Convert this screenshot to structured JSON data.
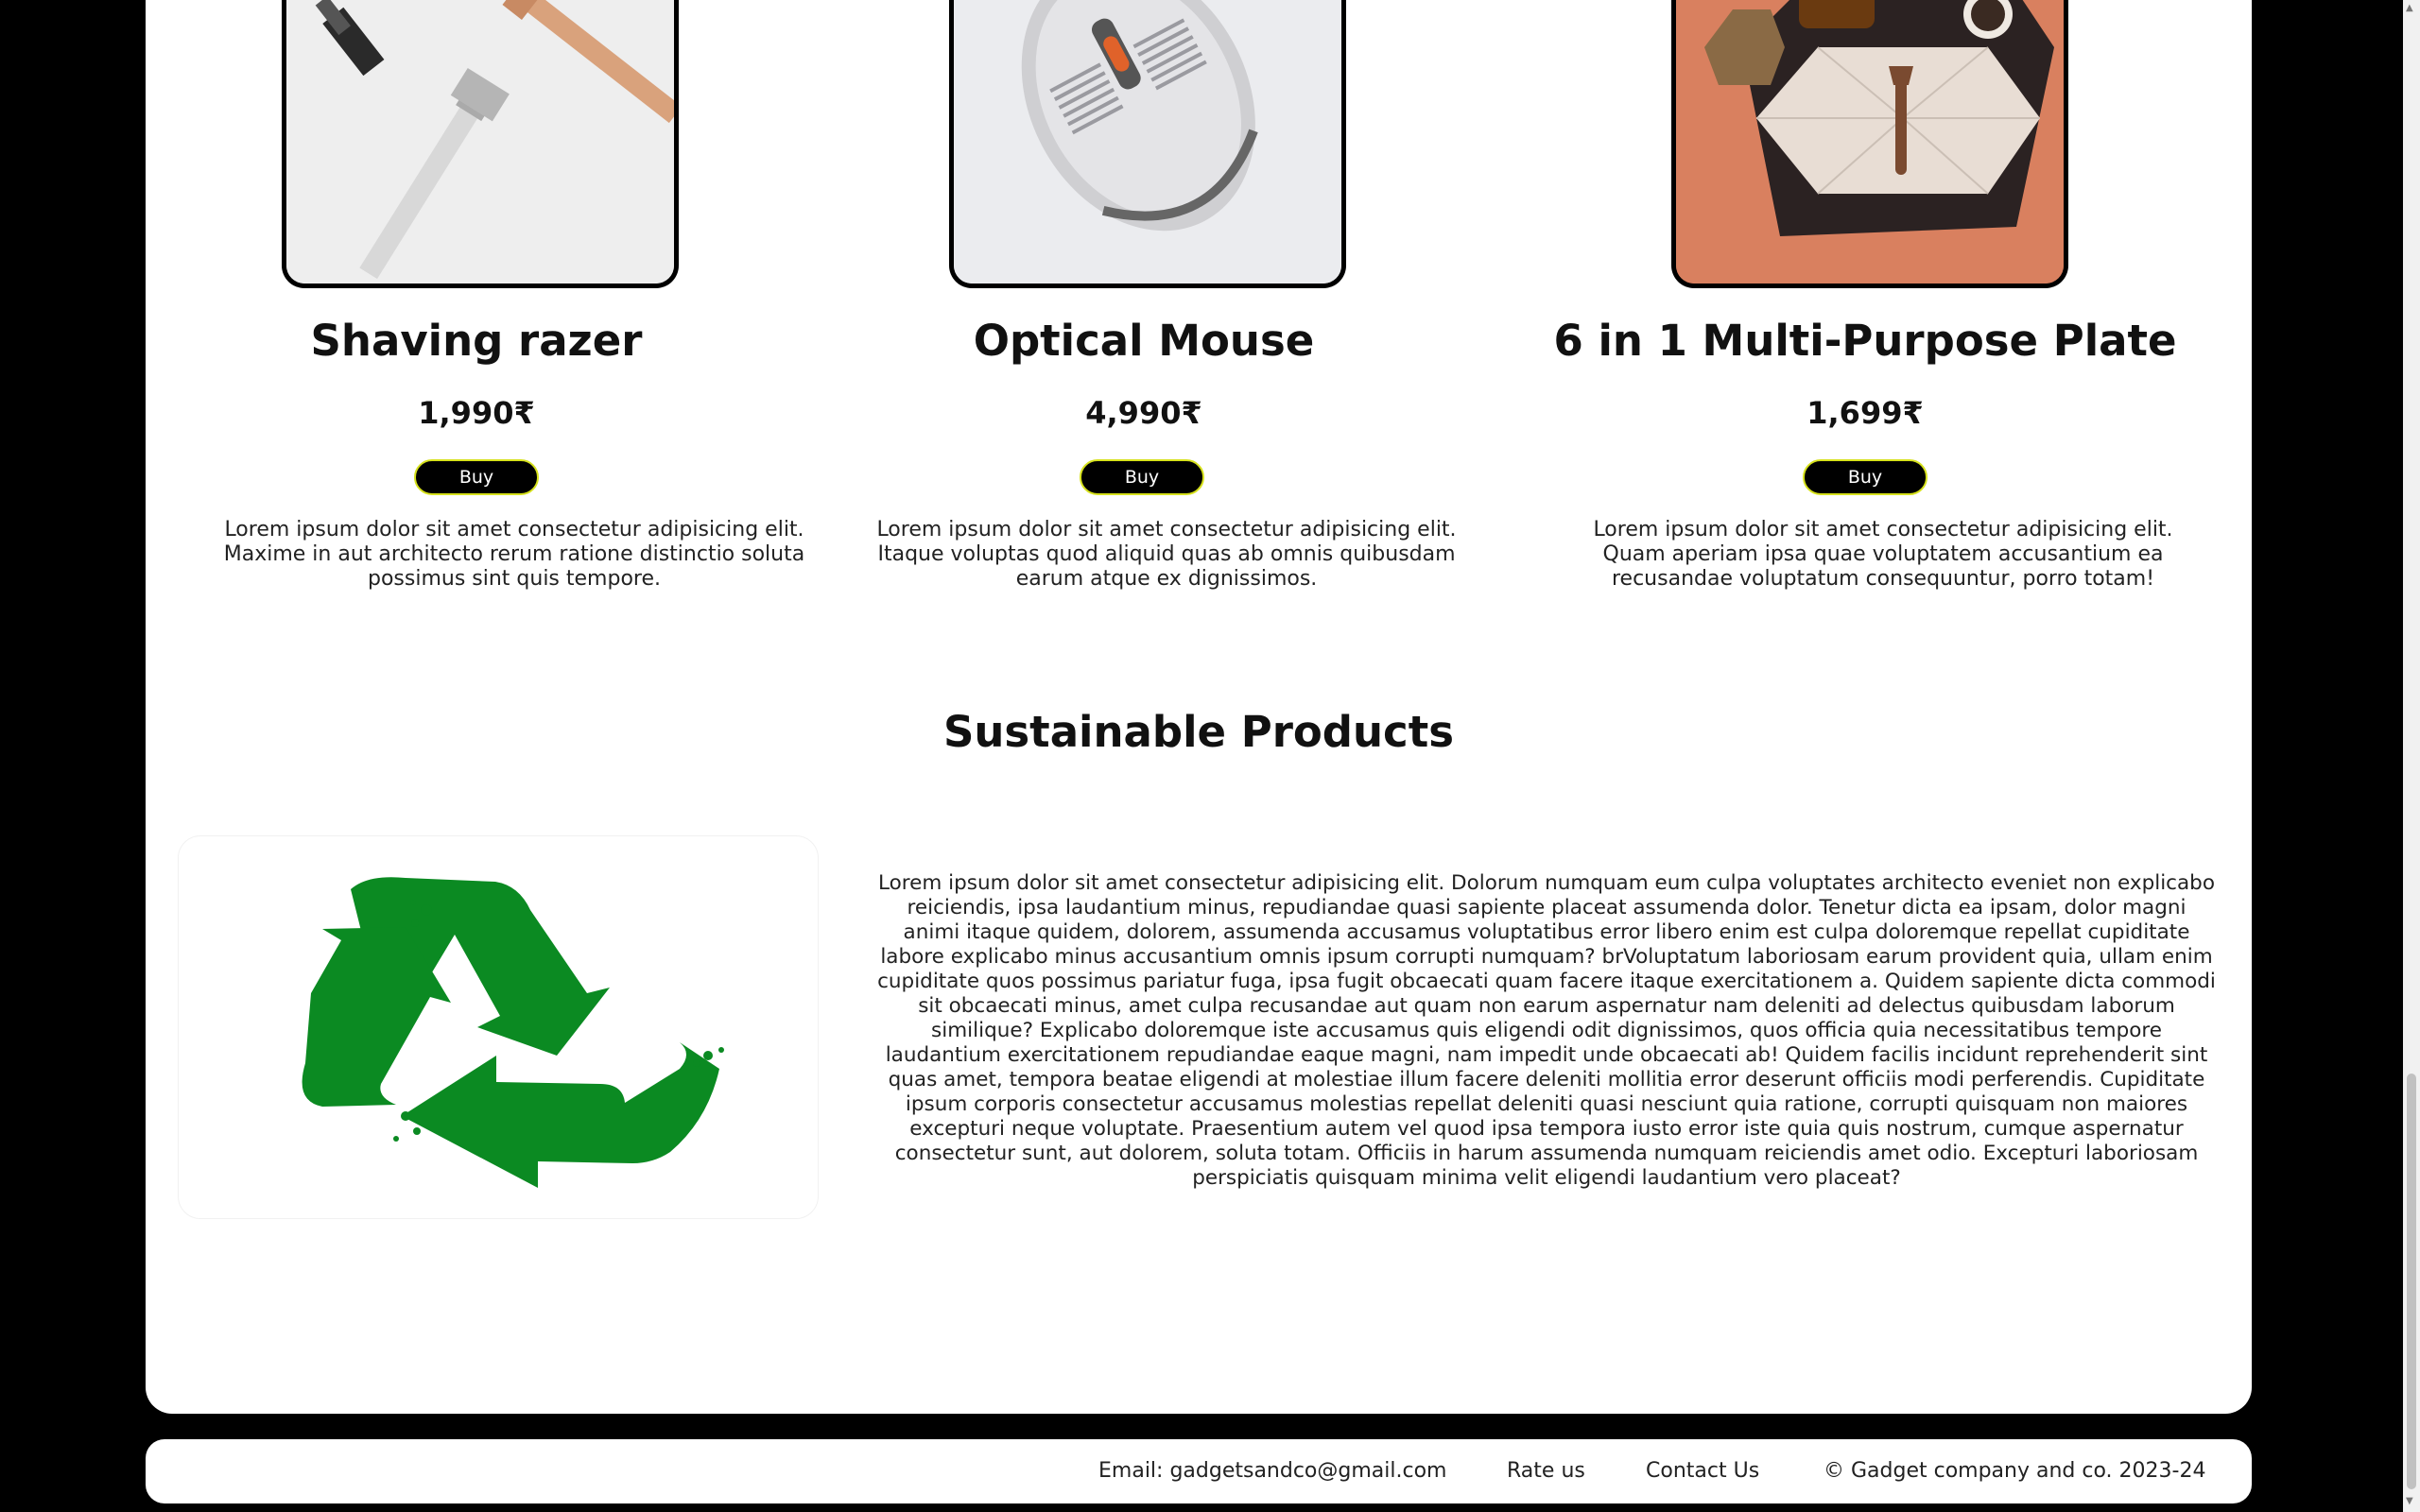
{
  "products": [
    {
      "name": "Shaving razer",
      "price": "1,990₹",
      "buy_label": "Buy",
      "description": "Lorem ipsum dolor sit amet consectetur adipisicing elit. Maxime in aut architecto rerum ratione distinctio soluta possimus sint quis tempore."
    },
    {
      "name": "Optical Mouse",
      "price": "4,990₹",
      "buy_label": "Buy",
      "description": "Lorem ipsum dolor sit amet consectetur adipisicing elit. Itaque voluptas quod aliquid quas ab omnis quibusdam earum atque ex dignissimos."
    },
    {
      "name": "6 in 1 Multi-Purpose Plate",
      "price": "1,699₹",
      "buy_label": "Buy",
      "description": "Lorem ipsum dolor sit amet consectetur adipisicing elit. Quam aperiam ipsa quae voluptatem accusantium ea recusandae voluptatum consequuntur, porro totam!"
    }
  ],
  "sustainable": {
    "title": "Sustainable Products",
    "icon": "recycle-icon",
    "description": "Lorem ipsum dolor sit amet consectetur adipisicing elit. Dolorum numquam eum culpa voluptates architecto eveniet non explicabo reiciendis, ipsa laudantium minus, repudiandae quasi sapiente placeat assumenda dolor. Tenetur dicta ea ipsam, dolor magni animi itaque quidem, dolorem, assumenda accusamus voluptatibus error libero enim est culpa doloremque repellat cupiditate labore explicabo minus accusantium omnis ipsum corrupti numquam? brVoluptatum laboriosam earum provident quia, ullam enim cupiditate quos possimus pariatur fuga, ipsa fugit obcaecati quam facere itaque exercitationem a. Quidem sapiente dicta commodi sit obcaecati minus, amet culpa recusandae aut quam non earum aspernatur nam deleniti ad delectus quibusdam laborum similique? Explicabo doloremque iste accusamus quis eligendi odit dignissimos, quos officia quia necessitatibus tempore laudantium exercitationem repudiandae eaque magni, nam impedit unde obcaecati ab! Quidem facilis incidunt reprehenderit sint quas amet, tempora beatae eligendi at molestiae illum facere deleniti mollitia error deserunt officiis modi perferendis. Cupiditate ipsum corporis consectetur accusamus molestias repellat deleniti quasi nesciunt quia ratione, corrupti quisquam non maiores excepturi neque voluptate. Praesentium autem vel quod ipsa tempora iusto error iste quia quis nostrum, cumque aspernatur consectetur sunt, aut dolorem, soluta totam. Officiis in harum assumenda numquam reiciendis amet odio. Excepturi laboriosam perspiciatis quisquam minima velit eligendi laudantium vero placeat?"
  },
  "footer": {
    "email": "Email: gadgetsandco@gmail.com",
    "rate": "Rate us",
    "contact": "Contact Us",
    "copyright": "© Gadget company and co. 2023-24"
  },
  "colors": {
    "page_bg": "#000000",
    "panel_bg": "#ffffff",
    "button_bg": "#000000",
    "button_border": "#d6e11c",
    "recycle_green": "#0b8a22",
    "plate_bg": "#d9805f"
  }
}
